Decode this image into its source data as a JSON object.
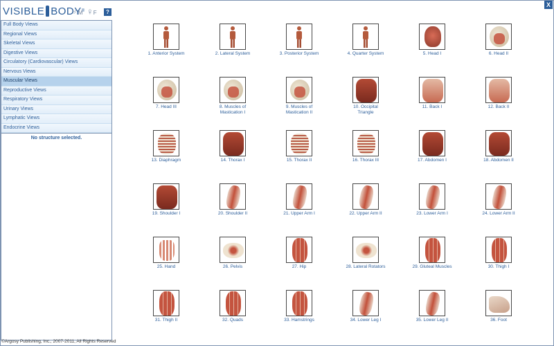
{
  "header": {
    "logo_left": "VISIBLE",
    "logo_right": "BODY",
    "logo_mark": "®",
    "male_label": "M",
    "female_label": "F",
    "help_label": "?",
    "close_label": "X"
  },
  "sidebar": {
    "items": [
      {
        "label": "Full Body Views",
        "active": false
      },
      {
        "label": "Regional Views",
        "active": false
      },
      {
        "label": "Skeletal Views",
        "active": false
      },
      {
        "label": "Digestive Views",
        "active": false
      },
      {
        "label": "Circulatory (Cardiovascular) Views",
        "active": false
      },
      {
        "label": "Nervous Views",
        "active": false
      },
      {
        "label": "Muscular Views",
        "active": true
      },
      {
        "label": "Reproductive Views",
        "active": false
      },
      {
        "label": "Respiratory Views",
        "active": false
      },
      {
        "label": "Urinary Views",
        "active": false
      },
      {
        "label": "Lymphatic Views",
        "active": false
      },
      {
        "label": "Endocrine Views",
        "active": false
      }
    ],
    "status": "No structure selected."
  },
  "footer": "©Argosy Publishing, Inc., 2007-2011, All Rights Reserved",
  "views": [
    {
      "label": "1. Anterior System",
      "art": "fig"
    },
    {
      "label": "2. Lateral System",
      "art": "fig"
    },
    {
      "label": "3. Posterior System",
      "art": "fig"
    },
    {
      "label": "4. Quarter System",
      "art": "fig"
    },
    {
      "label": "5. Head I",
      "art": "head"
    },
    {
      "label": "6. Head II",
      "art": "skull"
    },
    {
      "label": "7. Head III",
      "art": "skull"
    },
    {
      "label": "8. Muscles of Mastication I",
      "art": "skull"
    },
    {
      "label": "9. Muscles of Mastication II",
      "art": "skull"
    },
    {
      "label": "10. Occipital Triangle",
      "art": "torso-dark"
    },
    {
      "label": "11. Back I",
      "art": "torso"
    },
    {
      "label": "12. Back II",
      "art": "torso"
    },
    {
      "label": "13. Diaphragm",
      "art": "ribs"
    },
    {
      "label": "14. Thorax I",
      "art": "torso-dark"
    },
    {
      "label": "15. Thorax II",
      "art": "ribs"
    },
    {
      "label": "16. Thorax III",
      "art": "ribs"
    },
    {
      "label": "17. Abdomen I",
      "art": "torso-dark"
    },
    {
      "label": "18. Abdomen II",
      "art": "torso-dark"
    },
    {
      "label": "19. Shoulder I",
      "art": "torso-dark"
    },
    {
      "label": "20. Shoulder II",
      "art": "limb"
    },
    {
      "label": "21. Upper Arm I",
      "art": "limb"
    },
    {
      "label": "22. Upper Arm II",
      "art": "limb"
    },
    {
      "label": "23. Lower Arm I",
      "art": "limb"
    },
    {
      "label": "24. Lower Arm II",
      "art": "limb"
    },
    {
      "label": "25. Hand",
      "art": "hand"
    },
    {
      "label": "26. Pelvis",
      "art": "pelvis"
    },
    {
      "label": "27. Hip",
      "art": "thigh"
    },
    {
      "label": "28. Lateral Rotators",
      "art": "pelvis"
    },
    {
      "label": "29. Gluteal Muscles",
      "art": "thigh"
    },
    {
      "label": "30. Thigh I",
      "art": "thigh"
    },
    {
      "label": "31. Thigh II",
      "art": "thigh"
    },
    {
      "label": "32. Quads",
      "art": "thigh"
    },
    {
      "label": "33. Hamstrings",
      "art": "thigh"
    },
    {
      "label": "34. Lower Leg I",
      "art": "limb"
    },
    {
      "label": "35. Lower Leg II",
      "art": "limb"
    },
    {
      "label": "36. Foot",
      "art": "foot"
    }
  ]
}
